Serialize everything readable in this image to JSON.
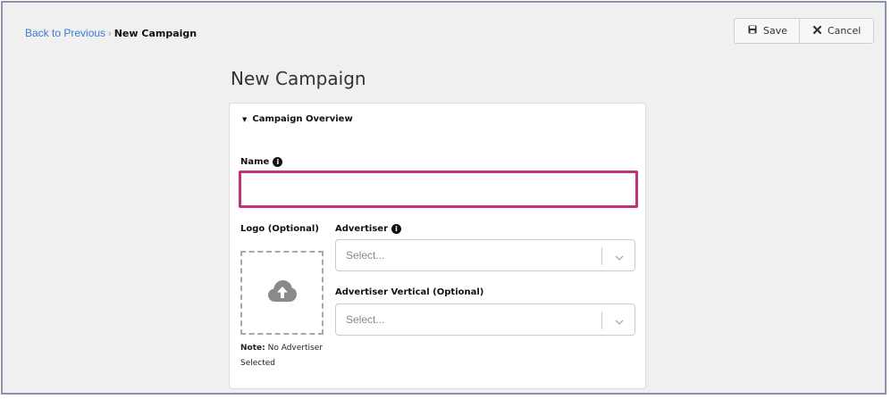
{
  "breadcrumb": {
    "back_label": "Back to Previous",
    "separator": "›",
    "current": "New Campaign"
  },
  "toolbar": {
    "save_label": "Save",
    "cancel_label": "Cancel"
  },
  "page": {
    "title": "New Campaign"
  },
  "overview": {
    "section_title": "Campaign Overview",
    "name_label": "Name",
    "name_value": "",
    "logo_label": "Logo (Optional)",
    "advertiser_label": "Advertiser",
    "advertiser_placeholder": "Select...",
    "vertical_label": "Advertiser Vertical (Optional)",
    "vertical_placeholder": "Select...",
    "note_prefix": "Note:",
    "note_text": " No Advertiser Selected"
  },
  "colors": {
    "accent_focus": "#c2327a",
    "link": "#3a7bd5",
    "background": "#f0f0f0"
  },
  "icons": {
    "save": "floppy-disk-icon",
    "cancel": "x-icon",
    "info": "info-circle-icon",
    "upload": "cloud-upload-icon",
    "dropdown": "chevron-down-icon",
    "collapse": "caret-down-icon"
  }
}
